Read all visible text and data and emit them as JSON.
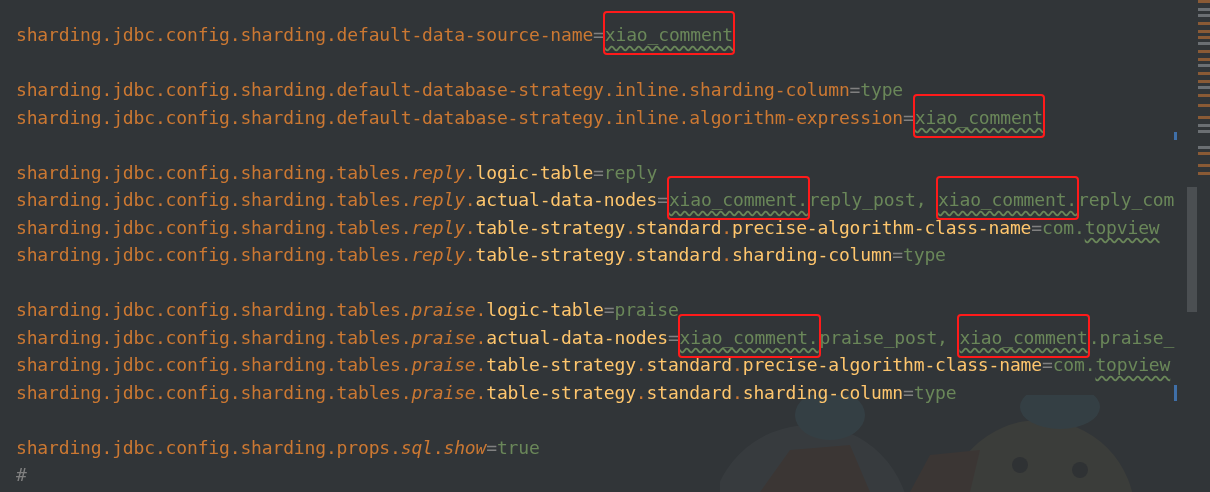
{
  "editor": {
    "lines": [
      {
        "gap_before": false,
        "tokens": [
          {
            "kind": "key",
            "text": "sharding.jdbc.config.sharding.default-data-source-name"
          },
          {
            "kind": "eq",
            "text": "="
          },
          {
            "kind": "value",
            "text": "xiao_comment",
            "typo": true,
            "boxed": true
          }
        ]
      },
      {
        "gap_before": true,
        "tokens": [
          {
            "kind": "key",
            "text": "sharding.jdbc.config.sharding.default-database-strategy.inline.sharding-column"
          },
          {
            "kind": "eq",
            "text": "="
          },
          {
            "kind": "value",
            "text": "type"
          }
        ]
      },
      {
        "gap_before": false,
        "tokens": [
          {
            "kind": "key",
            "text": "sharding.jdbc.config.sharding.default-database-strategy.inline.algorithm-expression"
          },
          {
            "kind": "eq",
            "text": "="
          },
          {
            "kind": "value",
            "text": "xiao_comment",
            "typo": true,
            "boxed": true
          }
        ]
      },
      {
        "gap_before": true,
        "tokens": [
          {
            "kind": "key",
            "text": "sharding.jdbc.config.sharding.tables."
          },
          {
            "kind": "italic",
            "text": "reply"
          },
          {
            "kind": "dot",
            "text": "."
          },
          {
            "kind": "sub",
            "text": "logic-table"
          },
          {
            "kind": "eq",
            "text": "="
          },
          {
            "kind": "value",
            "text": "reply"
          }
        ]
      },
      {
        "gap_before": false,
        "tokens": [
          {
            "kind": "key",
            "text": "sharding.jdbc.config.sharding.tables."
          },
          {
            "kind": "italic",
            "text": "reply"
          },
          {
            "kind": "dot",
            "text": "."
          },
          {
            "kind": "sub",
            "text": "actual-data-nodes"
          },
          {
            "kind": "eq",
            "text": "="
          },
          {
            "kind": "value",
            "text": "xiao_comment.",
            "typo": true,
            "boxed": true
          },
          {
            "kind": "value",
            "text": "reply_post, "
          },
          {
            "kind": "value",
            "text": "xiao_comment.",
            "typo": true,
            "boxed": true
          },
          {
            "kind": "value",
            "text": "reply_com"
          }
        ]
      },
      {
        "gap_before": false,
        "tokens": [
          {
            "kind": "key",
            "text": "sharding.jdbc.config.sharding.tables."
          },
          {
            "kind": "italic",
            "text": "reply"
          },
          {
            "kind": "dot",
            "text": "."
          },
          {
            "kind": "sub",
            "text": "table-strategy"
          },
          {
            "kind": "dot",
            "text": "."
          },
          {
            "kind": "sub",
            "text": "standard"
          },
          {
            "kind": "dot",
            "text": "."
          },
          {
            "kind": "sub",
            "text": "precise-algorithm-class-name"
          },
          {
            "kind": "eq",
            "text": "="
          },
          {
            "kind": "value",
            "text": "com."
          },
          {
            "kind": "value",
            "text": "topview",
            "typo": true
          }
        ]
      },
      {
        "gap_before": false,
        "tokens": [
          {
            "kind": "key",
            "text": "sharding.jdbc.config.sharding.tables."
          },
          {
            "kind": "italic",
            "text": "reply"
          },
          {
            "kind": "dot",
            "text": "."
          },
          {
            "kind": "sub",
            "text": "table-strategy"
          },
          {
            "kind": "dot",
            "text": "."
          },
          {
            "kind": "sub",
            "text": "standard"
          },
          {
            "kind": "dot",
            "text": "."
          },
          {
            "kind": "sub",
            "text": "sharding-column"
          },
          {
            "kind": "eq",
            "text": "="
          },
          {
            "kind": "value",
            "text": "type"
          }
        ]
      },
      {
        "gap_before": true,
        "tokens": [
          {
            "kind": "key",
            "text": "sharding.jdbc.config.sharding.tables."
          },
          {
            "kind": "italic",
            "text": "praise"
          },
          {
            "kind": "dot",
            "text": "."
          },
          {
            "kind": "sub",
            "text": "logic-table"
          },
          {
            "kind": "eq",
            "text": "="
          },
          {
            "kind": "value",
            "text": "praise"
          }
        ]
      },
      {
        "gap_before": false,
        "tokens": [
          {
            "kind": "key",
            "text": "sharding.jdbc.config.sharding.tables."
          },
          {
            "kind": "italic",
            "text": "praise"
          },
          {
            "kind": "dot",
            "text": "."
          },
          {
            "kind": "sub",
            "text": "actual-data-nodes"
          },
          {
            "kind": "eq",
            "text": "="
          },
          {
            "kind": "value",
            "text": "xiao_comment.",
            "typo": true,
            "boxed": true
          },
          {
            "kind": "value",
            "text": "praise_post, "
          },
          {
            "kind": "value",
            "text": "xiao_comment",
            "typo": true,
            "boxed": true
          },
          {
            "kind": "value",
            "text": ".praise_"
          }
        ]
      },
      {
        "gap_before": false,
        "tokens": [
          {
            "kind": "key",
            "text": "sharding.jdbc.config.sharding.tables."
          },
          {
            "kind": "italic",
            "text": "praise"
          },
          {
            "kind": "dot",
            "text": "."
          },
          {
            "kind": "sub",
            "text": "table-strategy"
          },
          {
            "kind": "dot",
            "text": "."
          },
          {
            "kind": "sub",
            "text": "standard"
          },
          {
            "kind": "dot",
            "text": "."
          },
          {
            "kind": "sub",
            "text": "precise-algorithm-class-name"
          },
          {
            "kind": "eq",
            "text": "="
          },
          {
            "kind": "value",
            "text": "com."
          },
          {
            "kind": "value",
            "text": "topview",
            "typo": true
          }
        ]
      },
      {
        "gap_before": false,
        "tokens": [
          {
            "kind": "key",
            "text": "sharding.jdbc.config.sharding.tables."
          },
          {
            "kind": "italic",
            "text": "praise"
          },
          {
            "kind": "dot",
            "text": "."
          },
          {
            "kind": "sub",
            "text": "table-strategy"
          },
          {
            "kind": "dot",
            "text": "."
          },
          {
            "kind": "sub",
            "text": "standard"
          },
          {
            "kind": "dot",
            "text": "."
          },
          {
            "kind": "sub",
            "text": "sharding-column"
          },
          {
            "kind": "eq",
            "text": "="
          },
          {
            "kind": "value",
            "text": "type"
          }
        ]
      },
      {
        "gap_before": true,
        "tokens": [
          {
            "kind": "key",
            "text": "sharding.jdbc.config.sharding.props."
          },
          {
            "kind": "italic",
            "text": "sql"
          },
          {
            "kind": "dot",
            "text": "."
          },
          {
            "kind": "italic",
            "text": "show"
          },
          {
            "kind": "eq",
            "text": "="
          },
          {
            "kind": "value",
            "text": "true"
          }
        ]
      },
      {
        "gap_before": false,
        "tokens": [
          {
            "kind": "comment",
            "text": "#"
          }
        ]
      }
    ]
  }
}
